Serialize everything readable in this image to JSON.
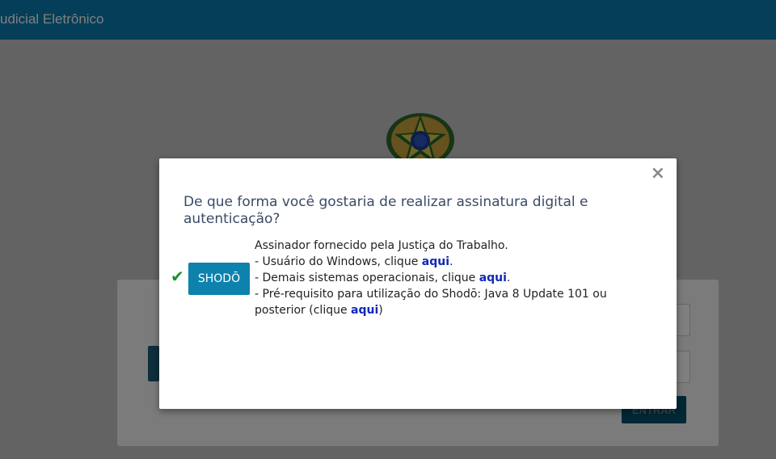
{
  "header": {
    "title": "udicial Eletrônico"
  },
  "background": {
    "enter_button_label": "ENTRAR"
  },
  "modal": {
    "close_glyph": "×",
    "question": "De que forma você gostaria de realizar assinatura digital e autenticação?",
    "option": {
      "check_glyph": "✔",
      "button_label": "SHODŌ",
      "line1": "Assinador fornecido pela Justiça do Trabalho.",
      "line2_text": "- Usuário do Windows, clique ",
      "line2_link": "aqui",
      "line2_end": ".",
      "line3_text": "- Demais sistemas operacionais, clique ",
      "line3_link": "aqui",
      "line3_end": ".",
      "line4_text": "- Pré-requisito para utilização do Shodō: Java 8 Update 101 ou posterior (clique ",
      "line4_link": "aqui",
      "line4_end": ")"
    }
  },
  "colors": {
    "header": "#0b7db1",
    "button": "#0d82ad",
    "link": "#1028b8",
    "check": "#1b8f2a",
    "question_text": "#3a4a66"
  }
}
